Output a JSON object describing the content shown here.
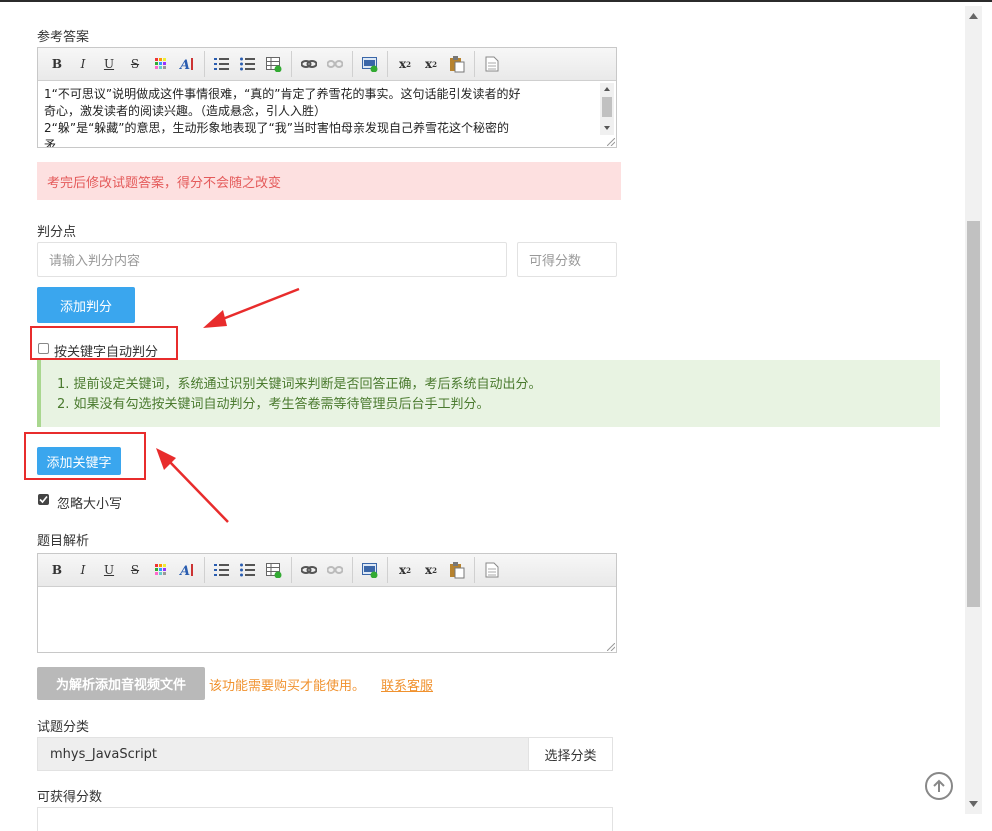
{
  "answer": {
    "label": "参考答案",
    "lines": [
      "1“不可思议”说明做成这件事情很难，“真的”肯定了养雪花的事实。这句话能引发读者的好",
      "奇心，激发读者的阅读兴趣。（造成悬念，引人入胜）",
      "2“躲”是“躲藏”的意思，生动形象地表现了“我”当时害怕母亲发现自己养雪花这个秘密的",
      "矛"
    ]
  },
  "toolbar": {
    "buttons": [
      "bold-icon",
      "italic-icon",
      "underline-icon",
      "strikethrough-icon",
      "text-color-icon",
      "font-style-icon",
      "ordered-list-icon",
      "unordered-list-icon",
      "table-icon",
      "link-icon",
      "unlink-icon",
      "image-icon",
      "superscript-icon",
      "subscript-icon",
      "paste-icon",
      "source-icon"
    ],
    "bold": "B",
    "italic": "I",
    "underline": "U",
    "strike": "S",
    "sup": "x",
    "sup2": "2",
    "sub": "x",
    "sub2": "2"
  },
  "warning": "考完后修改试题答案，得分不会随之改变",
  "scoring": {
    "label": "判分点",
    "content_placeholder": "请输入判分内容",
    "score_placeholder": "可得分数",
    "add_button": "添加判分"
  },
  "keyword_auto": {
    "label": "按关键字自动判分",
    "checked": false
  },
  "tips": [
    "1. 提前设定关键词，系统通过识别关键词来判断是否回答正确，考后系统自动出分。",
    "2. 如果没有勾选按关键词自动判分，考生答卷需等待管理员后台手工判分。"
  ],
  "add_keyword_button": "添加关键字",
  "ignore_case": {
    "label": "忽略大小写",
    "checked": true
  },
  "analysis": {
    "label": "题目解析"
  },
  "media": {
    "button": "为解析添加音视频文件",
    "notice": "该功能需要购买才能使用。",
    "contact": "联系客服"
  },
  "category": {
    "label": "试题分类",
    "value": "mhys_JavaScript",
    "select_button": "选择分类"
  },
  "score": {
    "label": "可获得分数"
  },
  "colors": {
    "accent": "#3aa6ee",
    "callout": "#e82c2c",
    "warning_bg": "#fde0e0",
    "tip_bg": "#e8f3e2"
  }
}
